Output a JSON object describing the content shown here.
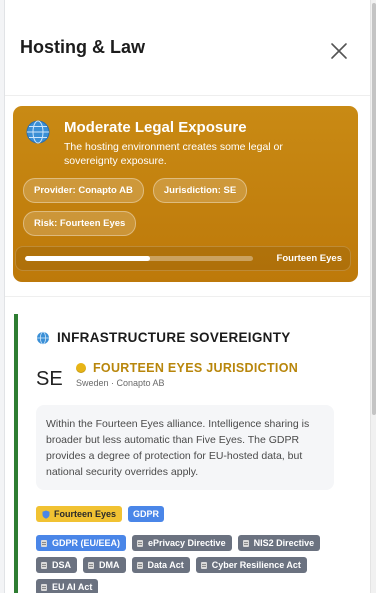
{
  "panel": {
    "title": "Hosting & Law"
  },
  "exposure": {
    "icon": "globe-icon",
    "title": "Moderate Legal Exposure",
    "description": "The hosting environment creates some legal or sovereignty exposure.",
    "chips": [
      {
        "label": "Provider: Conapto AB"
      },
      {
        "label": "Jurisdiction: SE"
      },
      {
        "label": "Risk: Fourteen Eyes"
      }
    ],
    "progress_fraction": 0.55,
    "progress_label": "Fourteen Eyes",
    "color": "#c4820f"
  },
  "sovereignty": {
    "icon": "globe-icon",
    "title": "INFRASTRUCTURE SOVEREIGNTY",
    "accent_color": "#2e7d32",
    "country_code": "SE",
    "jurisdiction_title": "FOURTEEN EYES JURISDICTION",
    "jurisdiction_color": "#b8860b",
    "jurisdiction_sub": "Sweden · Conapto AB",
    "info": "Within the Fourteen Eyes alliance. Intelligence sharing is broader but less automatic than Five Eyes. The GDPR provides a degree of protection for EU-hosted data, but national security overrides apply.",
    "tags": {
      "alliance": "Fourteen Eyes",
      "gdpr": "GDPR"
    },
    "laws": [
      {
        "label": "GDPR (EU/EEA)",
        "style": "blue"
      },
      {
        "label": "ePrivacy Directive",
        "style": "gray"
      },
      {
        "label": "NIS2 Directive",
        "style": "gray"
      },
      {
        "label": "DSA",
        "style": "gray"
      },
      {
        "label": "DMA",
        "style": "gray"
      },
      {
        "label": "Data Act",
        "style": "gray"
      },
      {
        "label": "Cyber Resilience Act",
        "style": "gray"
      },
      {
        "label": "EU AI Act",
        "style": "gray"
      }
    ]
  }
}
